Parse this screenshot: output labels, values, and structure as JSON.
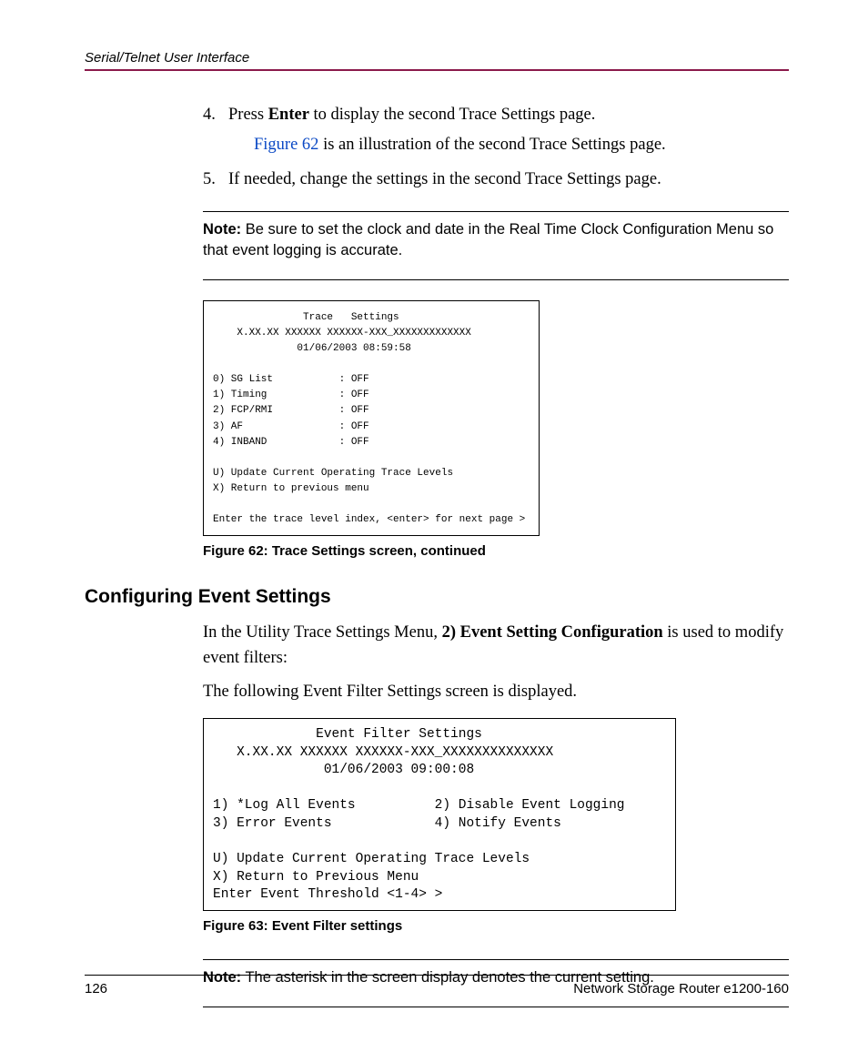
{
  "header": {
    "running_title": "Serial/Telnet User Interface"
  },
  "steps": {
    "s4_num": "4.",
    "s4_a": "Press ",
    "s4_bold": "Enter",
    "s4_b": " to display the second Trace Settings page.",
    "s4_sub_link": "Figure 62",
    "s4_sub_rest": " is an illustration of the second Trace Settings page.",
    "s5_num": "5.",
    "s5_text": "If needed, change the settings in the second Trace Settings page."
  },
  "note1": {
    "label": "Note:",
    "body": "  Be sure to set the clock and date in the Real Time Clock Configuration Menu so that event logging is accurate."
  },
  "fig62": {
    "text": "               Trace   Settings\n    X.XX.XX XXXXXX XXXXXX-XXX_XXXXXXXXXXXXX\n              01/06/2003 08:59:58\n\n0) SG List           : OFF\n1) Timing            : OFF\n2) FCP/RMI           : OFF\n3) AF                : OFF\n4) INBAND            : OFF\n\nU) Update Current Operating Trace Levels\nX) Return to previous menu\n\nEnter the trace level index, <enter> for next page >",
    "caption": "Figure 62:  Trace Settings screen, continued"
  },
  "section": {
    "heading": "Configuring Event Settings",
    "p1_a": "In the Utility Trace Settings Menu, ",
    "p1_bold": "2) Event Setting Configuration",
    "p1_b": " is used to modify event filters:",
    "p2": "The following Event Filter Settings screen is displayed."
  },
  "fig63": {
    "text": "             Event Filter Settings\n   X.XX.XX XXXXXX XXXXXX-XXX_XXXXXXXXXXXXXX\n              01/06/2003 09:00:08\n\n1) *Log All Events          2) Disable Event Logging\n3) Error Events             4) Notify Events\n\nU) Update Current Operating Trace Levels\nX) Return to Previous Menu\nEnter Event Threshold <1-4> >",
    "caption": "Figure 63:  Event Filter settings"
  },
  "note2": {
    "label": "Note:",
    "body": "  The asterisk in the screen display denotes the current setting."
  },
  "footer": {
    "page_number": "126",
    "doc_title": "Network Storage Router e1200-160"
  }
}
